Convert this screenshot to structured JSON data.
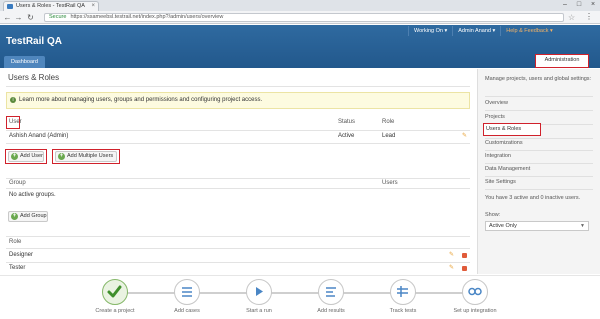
{
  "browser": {
    "tab_title": "Users & Roles - TestRail QA",
    "url_secure": "Secure",
    "url": "https://ssameebsl.testrail.net/index.php?/admin/users/overview"
  },
  "header": {
    "app_title": "TestRail QA",
    "top_menu": [
      "Working On ▾",
      "Admin Anand ▾",
      "Help & Feedback ▾"
    ],
    "dashboard_tab": "Dashboard",
    "admin_tab": "Administration"
  },
  "main": {
    "page_title": "Users & Roles",
    "help_text": "Learn more about managing users, groups and permissions and configuring project access.",
    "users": {
      "headers": {
        "user": "User",
        "status": "Status",
        "role": "Role"
      },
      "rows": [
        {
          "name": "Ashish Anand (Admin)",
          "status": "Active",
          "role": "Lead"
        }
      ],
      "add_user": "Add User",
      "add_multiple": "Add Multiple Users"
    },
    "groups": {
      "headers": {
        "group": "Group",
        "users": "Users"
      },
      "empty": "No active groups.",
      "add_group": "Add Group"
    },
    "roles": {
      "header": "Role",
      "rows": [
        "Designer",
        "Tester"
      ]
    }
  },
  "sidebar": {
    "intro": "Manage projects, users and global settings:",
    "items": [
      "Overview",
      "Projects",
      "Users & Roles",
      "Customizations",
      "Integration",
      "Data Management",
      "Site Settings"
    ],
    "active_index": 2,
    "license_text": "You have 3 active and 0 inactive users.",
    "show_label": "Show:",
    "show_value": "Active Only"
  },
  "workflow": {
    "steps": [
      "Create a project",
      "Add cases",
      "Start a run",
      "Add results",
      "Track tests",
      "Set up integration"
    ],
    "completed": 1
  },
  "colors": {
    "header_blue": "#2f6aa0",
    "highlight_red": "#d0212b",
    "add_green": "#6aa84f"
  }
}
